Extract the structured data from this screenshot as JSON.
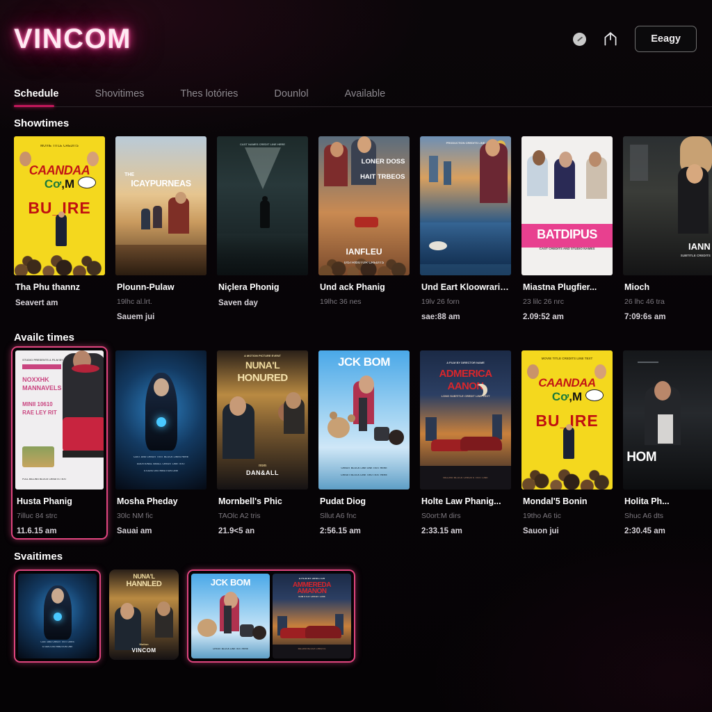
{
  "header": {
    "logo": "VINCOM",
    "icons": [
      {
        "name": "clock-icon",
        "glyph": "clock"
      },
      {
        "name": "share-icon",
        "glyph": "share"
      }
    ],
    "action_button": "Eeagy"
  },
  "tabs": [
    {
      "label": "Schedule",
      "active": true
    },
    {
      "label": "Shovitimes",
      "active": false
    },
    {
      "label": "Thes lotóries",
      "active": false
    },
    {
      "label": "Dounlol",
      "active": false
    },
    {
      "label": "Available",
      "active": false
    }
  ],
  "colors": {
    "accent": "#c2185b",
    "accent_bright": "#e0457f",
    "background": "#050406",
    "text_primary": "#ffffff",
    "text_muted": "#7e7a80"
  },
  "sections": [
    {
      "title": "Showtimes",
      "cards": [
        {
          "title": "Tha Phu thannz",
          "sub": "",
          "time": "Seavert am",
          "poster": "candaa-yellow",
          "selected": false
        },
        {
          "title": "Plounn-Pulaw",
          "sub": "19lhc al.lrt.",
          "time": "Sauem jui",
          "poster": "icaypurneas-sunset",
          "selected": false
        },
        {
          "title": "Niçlera Phonig",
          "sub": "",
          "time": "Saven day",
          "poster": "dark-alley-gun",
          "selected": false
        },
        {
          "title": "Und ack Phanig",
          "sub": "19lhc 36 nes",
          "time": "",
          "poster": "lover-loss-couple",
          "selected": false
        },
        {
          "title": "Und Eart Kloowrariy...",
          "sub": "19lv 26 forn",
          "time": "sae:88 am",
          "poster": "city-flood-man",
          "selected": false
        },
        {
          "title": "Miastna Plugfier...",
          "sub": "23 lilc 26 nrc",
          "time": "2.09:52 am",
          "poster": "batdipus-white",
          "selected": false
        },
        {
          "title": "Mioch",
          "sub": "26 lhc 46 tra",
          "time": "7:09:6s am",
          "poster": "lann-couple-dark",
          "selected": false
        }
      ]
    },
    {
      "title": "Availc times",
      "cards": [
        {
          "title": "Husta Phanig",
          "sub": "7illuc 84 strc",
          "time": "11.6.15 am",
          "poster": "pink-poster-figure",
          "selected": true
        },
        {
          "title": "Mosha Pheday",
          "sub": "30lc NM fic",
          "time": "Sauai am",
          "poster": "blue-alien-suit",
          "selected": false
        },
        {
          "title": "Mornbell's Phic",
          "sub": "TAOlc A2 tris",
          "time": "21.9<5 an",
          "poster": "nunal-honoured",
          "selected": false
        },
        {
          "title": "Pudat Diog",
          "sub": "Sllut A6 fnc",
          "time": "2:56.15 am",
          "poster": "jck-bom-bear",
          "selected": false
        },
        {
          "title": "Holte Law Phanig...",
          "sub": "S0ort:M dirs",
          "time": "2:33.15 am",
          "poster": "admerica-cars",
          "selected": false
        },
        {
          "title": "Mondal'5 Bonin",
          "sub": "19tho A6 tic",
          "time": "Sauon jui",
          "poster": "candaa-yellow",
          "selected": false
        },
        {
          "title": "Holita Ph...",
          "sub": "Shuc A6 dts",
          "time": "2:30.45 am",
          "poster": "hom-dark",
          "selected": false
        }
      ]
    },
    {
      "title": "Svaitimes",
      "thumbs": [
        {
          "poster": "blue-alien-suit",
          "framed": true,
          "group": 1
        },
        {
          "poster": "nunal-honoured",
          "framed": false,
          "group": 0
        },
        {
          "poster": "jck-bom-bear",
          "framed": true,
          "group": 2
        },
        {
          "poster": "admerica-cars",
          "framed": true,
          "group": 2
        }
      ]
    }
  ]
}
